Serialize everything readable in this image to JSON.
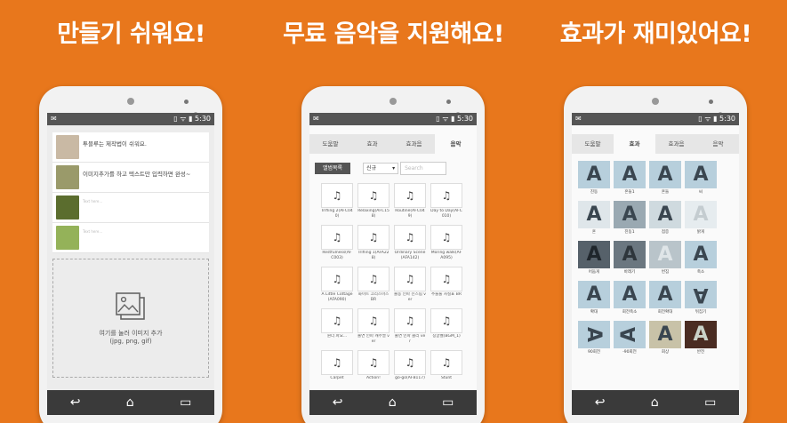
{
  "panels": [
    {
      "headline": "만들기 쉬워요!"
    },
    {
      "headline": "무료 음악을 지원해요!"
    },
    {
      "headline": "효과가 재미있어요!"
    }
  ],
  "status": {
    "time": "5:30",
    "icons": "▯ ᯤ ▮"
  },
  "nav": {
    "back": "↩",
    "home": "⌂",
    "recent": "▭"
  },
  "phone1": {
    "items": [
      {
        "text": "투블루는 제작법이 쉬워요.",
        "color": "#c9b9a4"
      },
      {
        "text": "이미지추가를 하고 텍스트만 입력하면 완성~",
        "color": "#9a9a6a"
      },
      {
        "text": "Text here...",
        "color": "#5b6d2e",
        "faint": true
      },
      {
        "text": "Text here...",
        "color": "#94b259",
        "faint": true
      }
    ],
    "add_label": "여기를 눌러 이미지 추가",
    "add_formats": "(jpg, png, gif)"
  },
  "tabs": [
    "도움말",
    "효과",
    "효과음",
    "음악"
  ],
  "phone2": {
    "list_button": "앨범목록",
    "select_value": "신규",
    "select_arrow": "▾",
    "search_placeholder": "Search",
    "note_icon": "♫",
    "tracks": [
      "Trifling 2(AFC040)",
      "Relaxing(AFC158)",
      "Routine(AFC049)",
      "Day to Day(AFC010)",
      "Restfulness(AFC003)",
      "Trifling 1(AFA228)",
      "Ordinary Scene(AFA142)",
      "Moring walk(AFA095)",
      "A Little Cottage(AFA090)",
      "화이트 크리스마스 BR",
      "출동 인파 신스림 ver",
      "추룰룰 사실표 BR",
      "원더 파요...",
      "출연 인파 캐주얼 ver",
      "출연 인파 클리 ver",
      "징글벨(BGM_1)",
      "Carpet",
      "Action!",
      "go-go(AFB117)",
      "Stunt"
    ]
  },
  "phone3": {
    "glyph": "A",
    "effects": [
      {
        "label": "진동",
        "bg": "#b7cfdc",
        "fg": "#3a4650"
      },
      {
        "label": "흔들1",
        "bg": "#b7cfdc",
        "fg": "#3a4650"
      },
      {
        "label": "흔들",
        "bg": "#b7cfdc",
        "fg": "#3a4650"
      },
      {
        "label": "씨",
        "bg": "#b7cfdc",
        "fg": "#3a4650"
      },
      {
        "label": "흔",
        "bg": "#dfe6ea",
        "fg": "#3a4650"
      },
      {
        "label": "진동1",
        "bg": "#9aa9b2",
        "fg": "#3a4650"
      },
      {
        "label": "점증",
        "bg": "#cfdadf",
        "fg": "#3a4650"
      },
      {
        "label": "밝게",
        "bg": "#e6ecef",
        "fg": "#c4ccd0"
      },
      {
        "label": "어둡게",
        "bg": "#56616a",
        "fg": "#1f262c"
      },
      {
        "label": "바래기",
        "bg": "#6b7780",
        "fg": "#2e363c"
      },
      {
        "label": "번짐",
        "bg": "#b9c4ca",
        "fg": "#dfe5e8"
      },
      {
        "label": "축소",
        "bg": "#b7cfdc",
        "fg": "#3a4650"
      },
      {
        "label": "확대",
        "bg": "#b7cfdc",
        "fg": "#3a4650"
      },
      {
        "label": "회전축소",
        "bg": "#b7cfdc",
        "fg": "#3a4650"
      },
      {
        "label": "회전확대",
        "bg": "#b7cfdc",
        "fg": "#3a4650"
      },
      {
        "label": "뒤집기",
        "bg": "#b7cfdc",
        "fg": "#3a4650"
      },
      {
        "label": "90회전",
        "bg": "#b7cfdc",
        "fg": "#3a4650",
        "rot": 90
      },
      {
        "label": "-90회전",
        "bg": "#b7cfdc",
        "fg": "#3a4650",
        "rot": -90
      },
      {
        "label": "회상",
        "bg": "#c8c2a8",
        "fg": "#3a4650"
      },
      {
        "label": "반전",
        "bg": "#4a2c22",
        "fg": "#c9d2c8"
      }
    ]
  }
}
